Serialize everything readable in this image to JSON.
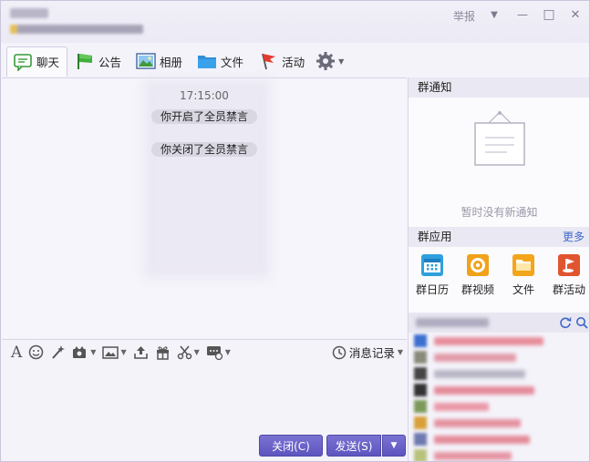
{
  "header": {
    "report_label": "举报",
    "min_symbol": "—",
    "max_symbol": "□",
    "close_symbol": "✕",
    "dropdown_symbol": "▼"
  },
  "tabs": [
    {
      "label": "聊天",
      "icon": "chat-bubble-icon"
    },
    {
      "label": "公告",
      "icon": "flag-icon"
    },
    {
      "label": "相册",
      "icon": "picture-icon"
    },
    {
      "label": "文件",
      "icon": "folder-icon"
    },
    {
      "label": "活动",
      "icon": "red-flag-icon"
    }
  ],
  "chat": {
    "time": "17:15:00",
    "messages": [
      "你开启了全员禁言",
      "你关闭了全员禁言"
    ]
  },
  "input_toolbar": {
    "history_label": "消息记录"
  },
  "buttons": {
    "close_label": "关闭(C)",
    "send_label": "发送(S)"
  },
  "notice": {
    "title": "群通知",
    "empty_text": "暂时没有新通知"
  },
  "group_apps": {
    "title": "群应用",
    "more_label": "更多",
    "items": [
      {
        "label": "群日历",
        "icon": "calendar-icon",
        "color": "#2f9fde"
      },
      {
        "label": "群视频",
        "icon": "camera-icon",
        "color": "#f0a21b"
      },
      {
        "label": "文件",
        "icon": "folder-icon",
        "color": "#f3a51c"
      },
      {
        "label": "群活动",
        "icon": "activity-flag-icon",
        "color": "#e0552f"
      }
    ]
  },
  "colors": {
    "accent_button": "#6a62c9",
    "link": "#3f66c9"
  }
}
